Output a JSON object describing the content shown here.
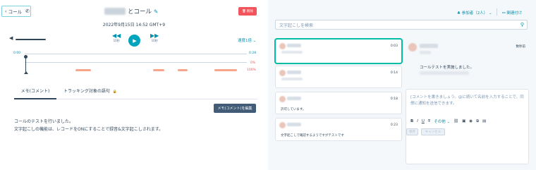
{
  "header": {
    "back_label": "コール",
    "title_suffix": "とコール",
    "delete_label": "削除",
    "datetime": "2022年9月15日 14:52 GMT+9"
  },
  "player": {
    "rewind_label": "10秒",
    "forward_label": "10秒",
    "speed_label": "速度1倍",
    "time_start": "0:00",
    "time_end": "0:28",
    "pct_top": "0%",
    "pct_bottom": "100%",
    "segments": [
      0.12,
      0.5,
      0.62,
      0.8
    ]
  },
  "tabs": {
    "notes": "メモ(コメント)",
    "tracking": "トラッキング対象の語句"
  },
  "notes": {
    "edit_label": "メモ(コメント)を編集",
    "line1": "コールのテストを行いました。",
    "line2": "文字起こしの機能は、レコードをONにすることで録音&文字起こしされます。"
  },
  "right_header": {
    "participants": "参加者（2人）",
    "associations": "関連付け"
  },
  "search": {
    "placeholder": "文字起こしを検索"
  },
  "transcript": [
    {
      "time": "0:03",
      "text": ""
    },
    {
      "time": "0:14",
      "text": ""
    },
    {
      "time": "0:18",
      "text": "許可しています。"
    },
    {
      "time": "0:23",
      "text": "文字起こしで確認するようですがテストです"
    }
  ],
  "comment": {
    "ago": "数秒前",
    "text": "コールテストを実施しました。",
    "editor_placeholder": "[コメントを書きましょう。@に続いて名前を入力することで、同僚に通知を送信できます。",
    "more_label": "その他",
    "save_label": "保存",
    "cancel_label": "キャンセル"
  },
  "colors": {
    "accent": "#00a4bd",
    "danger": "#f2545b",
    "segment": "#f7a68b"
  }
}
